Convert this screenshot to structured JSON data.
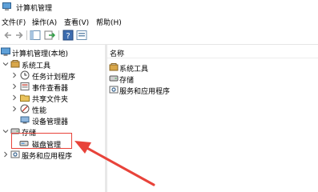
{
  "window": {
    "title": "计算机管理"
  },
  "menu": [
    "文件(F)",
    "操作(A)",
    "查看(V)",
    "帮助(H)"
  ],
  "toolbar_icons": [
    "back-icon",
    "forward-icon",
    "show-tree-icon",
    "export-icon",
    "help-icon",
    "properties-icon"
  ],
  "tree": {
    "root": "计算机管理(本地)",
    "system_tools": "系统工具",
    "system_children": [
      "任务计划程序",
      "事件查看器",
      "共享文件夹",
      "性能",
      "设备管理器"
    ],
    "storage": "存储",
    "disk_mgmt": "磁盘管理",
    "services": "服务和应用程序"
  },
  "list": {
    "header": "名称",
    "items": [
      "系统工具",
      "存储",
      "服务和应用程序"
    ]
  },
  "colors": {
    "highlight": "#e8433a",
    "arrow": "#e8433a"
  }
}
